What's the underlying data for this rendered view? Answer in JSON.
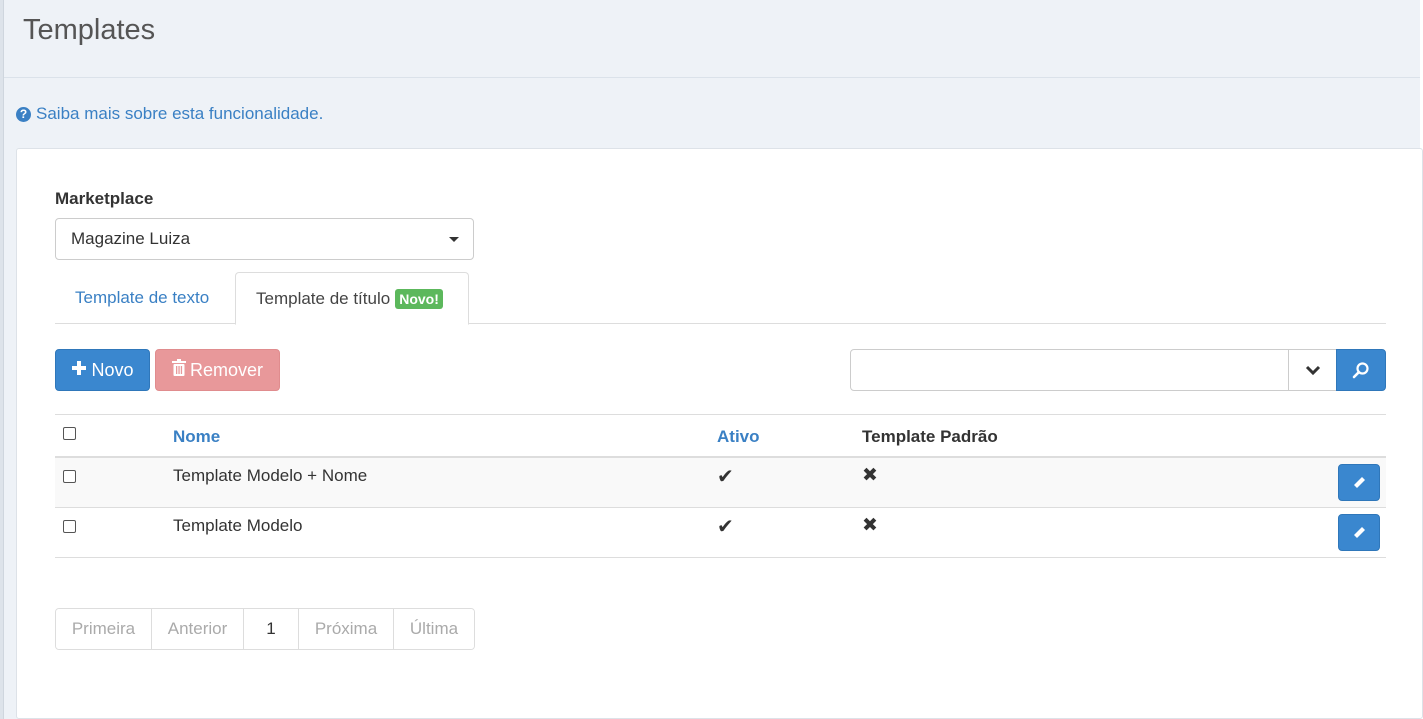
{
  "page": {
    "title": "Templates",
    "help_link": "Saiba mais sobre esta funcionalidade."
  },
  "form": {
    "marketplace_label": "Marketplace",
    "marketplace_value": "Magazine Luiza"
  },
  "tabs": [
    {
      "label": "Template de texto",
      "active": false
    },
    {
      "label": "Template de título",
      "active": true,
      "badge": "Novo!"
    }
  ],
  "toolbar": {
    "new_label": "Novo",
    "remove_label": "Remover",
    "search_value": ""
  },
  "table": {
    "headers": {
      "name": "Nome",
      "active": "Ativo",
      "default": "Template Padrão"
    },
    "rows": [
      {
        "name": "Template Modelo + Nome",
        "active": "✔",
        "default": "✖"
      },
      {
        "name": "Template Modelo",
        "active": "✔",
        "default": "✖"
      }
    ]
  },
  "pagination": {
    "first": "Primeira",
    "previous": "Anterior",
    "current": "1",
    "next": "Próxima",
    "last": "Última"
  },
  "colors": {
    "primary": "#3a87cf",
    "danger_disabled": "#e8989a",
    "badge_success": "#5cb85c",
    "link": "#3a80c4"
  }
}
